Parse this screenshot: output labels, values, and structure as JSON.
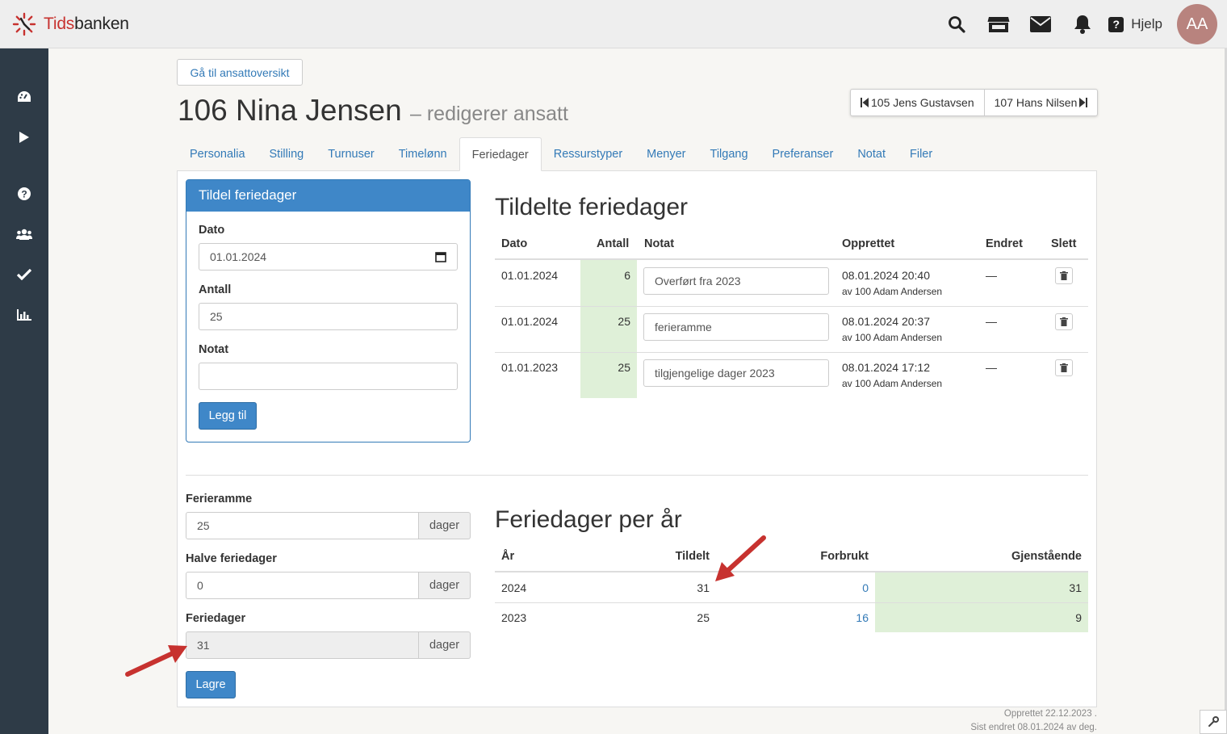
{
  "brand": {
    "name_part1": "Tids",
    "name_part2": "banken"
  },
  "topbar": {
    "icons": [
      "search-icon",
      "store-icon",
      "envelope-icon",
      "bell-icon"
    ],
    "help_label": "Hjelp",
    "avatar_initials": "AA"
  },
  "sidebar": {
    "icons": [
      "dashboard-icon",
      "play-icon",
      "question-icon",
      "users-icon",
      "check-icon",
      "chart-icon"
    ]
  },
  "back_button": "Gå til ansattoversikt",
  "page": {
    "title": "106 Nina Jensen",
    "subtitle": "– redigerer ansatt"
  },
  "pager": {
    "prev": "105 Jens Gustavsen",
    "next": "107 Hans Nilsen"
  },
  "tabs": [
    "Personalia",
    "Stilling",
    "Turnuser",
    "Timelønn",
    "Feriedager",
    "Ressurstyper",
    "Menyer",
    "Tilgang",
    "Preferanser",
    "Notat",
    "Filer"
  ],
  "active_tab": "Feriedager",
  "assign_form": {
    "title": "Tildel feriedager",
    "date_label": "Dato",
    "date_value": "01.01.2024",
    "count_label": "Antall",
    "count_value": "25",
    "note_label": "Notat",
    "note_value": "",
    "submit_label": "Legg til"
  },
  "assigned": {
    "heading": "Tildelte feriedager",
    "columns": [
      "Dato",
      "Antall",
      "Notat",
      "Opprettet",
      "Endret",
      "Slett"
    ],
    "rows": [
      {
        "date": "01.01.2024",
        "count": "6",
        "note": "Overført fra 2023",
        "created": "08.01.2024 20:40",
        "created_by": "av 100 Adam Andersen",
        "changed": "—"
      },
      {
        "date": "01.01.2024",
        "count": "25",
        "note": "ferieramme",
        "created": "08.01.2024 20:37",
        "created_by": "av 100 Adam Andersen",
        "changed": "—"
      },
      {
        "date": "01.01.2023",
        "count": "25",
        "note": "tilgjengelige dager 2023",
        "created": "08.01.2024 17:12",
        "created_by": "av 100 Adam Andersen",
        "changed": "—"
      }
    ]
  },
  "settings": {
    "frame_label": "Ferieramme",
    "frame_value": "25",
    "half_label": "Halve feriedager",
    "half_value": "0",
    "days_label": "Feriedager",
    "days_value": "31",
    "unit": "dager",
    "save_label": "Lagre"
  },
  "per_year": {
    "heading": "Feriedager per år",
    "columns": [
      "År",
      "Tildelt",
      "Forbrukt",
      "Gjenstående"
    ],
    "rows": [
      {
        "year": "2024",
        "assigned": "31",
        "used": "0",
        "remaining": "31"
      },
      {
        "year": "2023",
        "assigned": "25",
        "used": "16",
        "remaining": "9"
      }
    ]
  },
  "footer": {
    "created": "Opprettet 22.12.2023 .",
    "changed": "Sist endret 08.01.2024 av deg."
  },
  "colors": {
    "primary": "#3f87c8",
    "sidebar": "#2e3b47",
    "success_bg": "#dff0d8",
    "annotation_arrow": "#c7322f"
  }
}
